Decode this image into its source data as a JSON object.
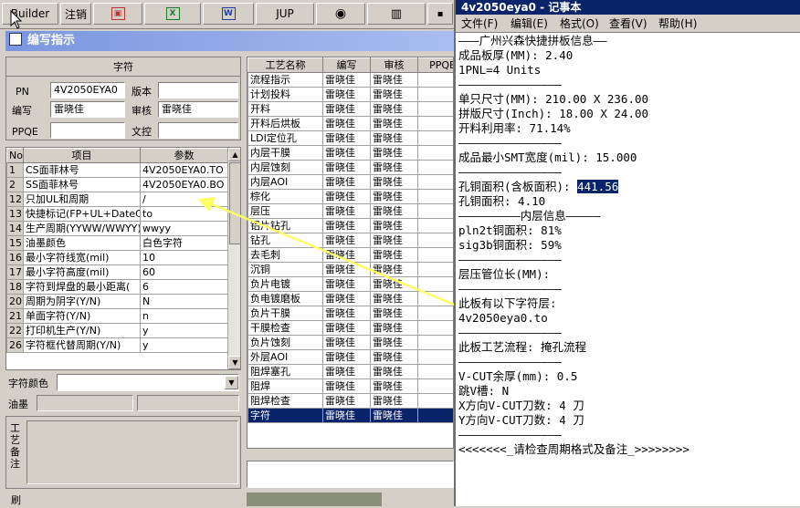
{
  "toolbar": {
    "builder_label": "Builder",
    "logout_label": "注销",
    "jup_label": "JUP"
  },
  "left_window": {
    "title": "编写指示",
    "char_panel": {
      "header": "字符",
      "pn_label": "PN",
      "pn_value": "4V2050EYA0",
      "version_label": "版本",
      "version_value": "",
      "writer_label": "编写",
      "writer_value": "雷晓佳",
      "reviewer_label": "审核",
      "reviewer_value": "雷晓佳",
      "ppqe_label": "PPQE",
      "ppqe_value": "",
      "control_label": "文控",
      "control_value": ""
    },
    "param_table": {
      "headers": [
        "No",
        "项目",
        "参数"
      ],
      "rows": [
        {
          "no": "1",
          "item": "CS面菲林号",
          "value": "4V2050EYA0.TO"
        },
        {
          "no": "2",
          "item": "SS面菲林号",
          "value": "4V2050EYA0.BO"
        },
        {
          "no": "12",
          "item": "只加UL和周期",
          "value": "/"
        },
        {
          "no": "13",
          "item": "快捷标记(FP+UL+DateCo",
          "value": "to"
        },
        {
          "no": "14",
          "item": "生产周期(YYWW/WWYY)",
          "value": "wwyy"
        },
        {
          "no": "15",
          "item": "油墨颜色",
          "value": "白色字符"
        },
        {
          "no": "16",
          "item": "最小字符线宽(mil)",
          "value": "10"
        },
        {
          "no": "17",
          "item": "最小字符高度(mil)",
          "value": "60"
        },
        {
          "no": "18",
          "item": "字符到焊盘的最小距离(",
          "value": "6"
        },
        {
          "no": "20",
          "item": "周期为阴字(Y/N)",
          "value": "N"
        },
        {
          "no": "21",
          "item": "单面字符(Y/N)",
          "value": "n"
        },
        {
          "no": "22",
          "item": "打印机生产(Y/N)",
          "value": "y"
        },
        {
          "no": "26",
          "item": "字符框代替周期(Y/N)",
          "value": "y"
        }
      ]
    },
    "char_color_label": "字符颜色",
    "char_color_value": "",
    "ink_label": "油墨",
    "remark_label": "工艺备注",
    "bottom_label": "刷",
    "process_table": {
      "headers": [
        "工艺名称",
        "编写",
        "审核",
        "PPQE"
      ],
      "rows": [
        {
          "name": "流程指示",
          "w": "雷晓佳",
          "r": "雷晓佳"
        },
        {
          "name": "计划投料",
          "w": "雷晓佳",
          "r": "雷晓佳"
        },
        {
          "name": "开料",
          "w": "雷晓佳",
          "r": "雷晓佳"
        },
        {
          "name": "开料后烘板",
          "w": "雷晓佳",
          "r": "雷晓佳"
        },
        {
          "name": "LDI定位孔",
          "w": "雷晓佳",
          "r": "雷晓佳"
        },
        {
          "name": "内层干膜",
          "w": "雷晓佳",
          "r": "雷晓佳"
        },
        {
          "name": "内层蚀刻",
          "w": "雷晓佳",
          "r": "雷晓佳"
        },
        {
          "name": "内层AOI",
          "w": "雷晓佳",
          "r": "雷晓佳"
        },
        {
          "name": "棕化",
          "w": "雷晓佳",
          "r": "雷晓佳"
        },
        {
          "name": "层压",
          "w": "雷晓佳",
          "r": "雷晓佳"
        },
        {
          "name": "铝片钻孔",
          "w": "雷晓佳",
          "r": "雷晓佳"
        },
        {
          "name": "钻孔",
          "w": "雷晓佳",
          "r": "雷晓佳"
        },
        {
          "name": "去毛刺",
          "w": "雷晓佳",
          "r": "雷晓佳"
        },
        {
          "name": "沉铜",
          "w": "雷晓佳",
          "r": "雷晓佳"
        },
        {
          "name": "负片电镀",
          "w": "雷晓佳",
          "r": "雷晓佳"
        },
        {
          "name": "负电镀磨板",
          "w": "雷晓佳",
          "r": "雷晓佳"
        },
        {
          "name": "负片干膜",
          "w": "雷晓佳",
          "r": "雷晓佳"
        },
        {
          "name": "干膜检查",
          "w": "雷晓佳",
          "r": "雷晓佳"
        },
        {
          "name": "负片蚀刻",
          "w": "雷晓佳",
          "r": "雷晓佳"
        },
        {
          "name": "外层AOI",
          "w": "雷晓佳",
          "r": "雷晓佳"
        },
        {
          "name": "阻焊塞孔",
          "w": "雷晓佳",
          "r": "雷晓佳"
        },
        {
          "name": "阻焊",
          "w": "雷晓佳",
          "r": "雷晓佳"
        },
        {
          "name": "阻焊检查",
          "w": "雷晓佳",
          "r": "雷晓佳"
        },
        {
          "name": "字符",
          "w": "雷晓佳",
          "r": "雷晓佳"
        }
      ]
    }
  },
  "notepad": {
    "title": "4v2050eya0 - 记事本",
    "menu": [
      "文件(F)",
      "编辑(E)",
      "格式(O)",
      "查看(V)",
      "帮助(H)"
    ],
    "lines": [
      "———广州兴森快捷拼板信息——",
      "成品板厚(MM): 2.40",
      "1PNL=4 Units",
      "———————————————",
      "单只尺寸(MM): 210.00 X 236.00",
      "拼版尺寸(Inch): 18.00 X 24.00",
      "开料利用率: 71.14%",
      "———————————————",
      "成品最小SMT宽度(mil): 15.000",
      "———————————————",
      "孔铜面积(含板面积): ",
      "孔铜面积: 4.10",
      "—————————内层信息—————",
      "pln2t铜面积: 81%",
      "sig3b铜面积: 59%",
      "———————————————",
      "层压管位长(MM):",
      "———————————————",
      "此板有以下字符层:",
      "4v2050eya0.to",
      "———————————————",
      "此板工艺流程: 掩孔流程",
      "———————————————",
      "V-CUT余厚(mm): 0.5",
      "跳V槽: N",
      "X方向V-CUT刀数: 4 刀",
      "Y方向V-CUT刀数: 4 刀",
      "———————————————",
      "<<<<<<<_请检查周期格式及备注_>>>>>>>>"
    ],
    "highlight_value": "441.56"
  }
}
